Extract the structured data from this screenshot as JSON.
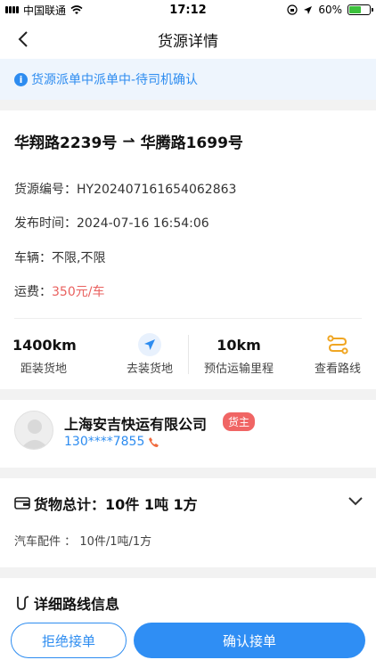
{
  "status_bar": {
    "carrier": "中国联通",
    "time": "17:12",
    "battery": "60%"
  },
  "nav": {
    "title": "货源详情"
  },
  "notice": {
    "text": "货源派单中派单中-待司机确认"
  },
  "route": {
    "from": "华翔路2239号",
    "arrow": "⇀",
    "to": "华腾路1699号"
  },
  "details": {
    "source_no_label": "货源编号：",
    "source_no": "HY202407161654062863",
    "publish_label": "发布时间：",
    "publish_time": "2024-07-16 16:54:06",
    "vehicle_label": "车辆：",
    "vehicle": "不限,不限",
    "fee_label": "运费：",
    "fee": "350元/车"
  },
  "stats": {
    "distance_to_pickup": "1400km",
    "distance_to_pickup_label": "距装货地",
    "go_pickup_label": "去装货地",
    "est_distance": "10km",
    "est_distance_label": "预估运输里程",
    "view_route_label": "查看路线"
  },
  "company": {
    "name": "上海安吉快运有限公司",
    "badge": "货主",
    "phone": "130****7855"
  },
  "goods": {
    "title": "货物总计：10件 1吨 1方",
    "detail_name": "汽车配件",
    "detail_sep": "：",
    "detail_value": "10件/1吨/1方"
  },
  "route_info": {
    "title": "详细路线信息"
  },
  "actions": {
    "reject": "拒绝接单",
    "confirm": "确认接单"
  },
  "colors": {
    "accent": "#2d8cf0",
    "fee": "#e9615f",
    "badge": "#f06564",
    "route_icon": "#f0a623"
  }
}
